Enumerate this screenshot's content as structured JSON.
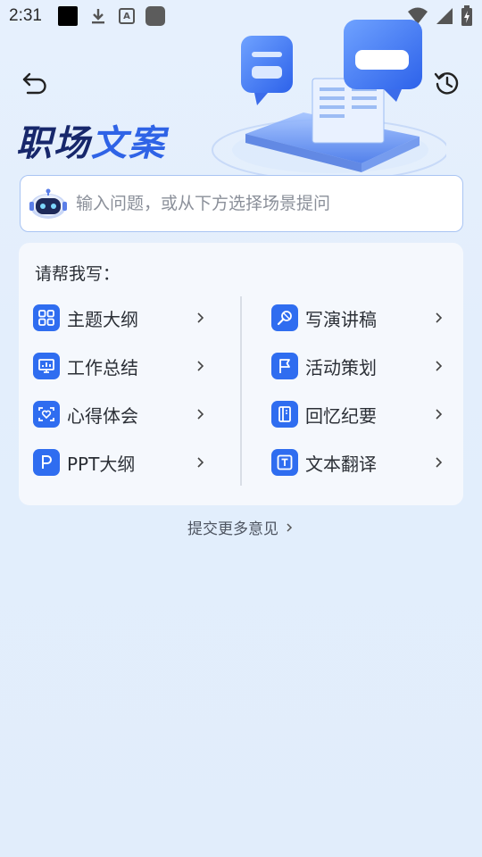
{
  "status_bar": {
    "time": "2:31",
    "icons": [
      "notification-black-icon",
      "download-icon",
      "a-icon",
      "app-icon",
      "wifi-icon",
      "signal-icon",
      "battery-icon"
    ]
  },
  "header": {
    "title_part1": "职场",
    "title_part2": "文案",
    "back_icon": "back-arrow-icon",
    "history_icon": "history-icon"
  },
  "search": {
    "placeholder": "输入问题，或从下方选择场景提问",
    "value": ""
  },
  "card": {
    "title": "请帮我写：",
    "items": [
      {
        "label": "主题大纲",
        "icon": "grid-icon"
      },
      {
        "label": "写演讲稿",
        "icon": "microphone-icon"
      },
      {
        "label": "工作总结",
        "icon": "presentation-icon"
      },
      {
        "label": "活动策划",
        "icon": "flag-icon"
      },
      {
        "label": "心得体会",
        "icon": "heart-scan-icon"
      },
      {
        "label": "回忆纪要",
        "icon": "notebook-icon"
      },
      {
        "label": "PPT大纲",
        "icon": "ppt-icon"
      },
      {
        "label": "文本翻译",
        "icon": "text-icon"
      }
    ]
  },
  "feedback": {
    "label": "提交更多意见"
  },
  "colors": {
    "accent": "#2f6df0",
    "title_dark": "#17276b",
    "title_blue": "#2f63e6",
    "background": "#e3eefc"
  }
}
